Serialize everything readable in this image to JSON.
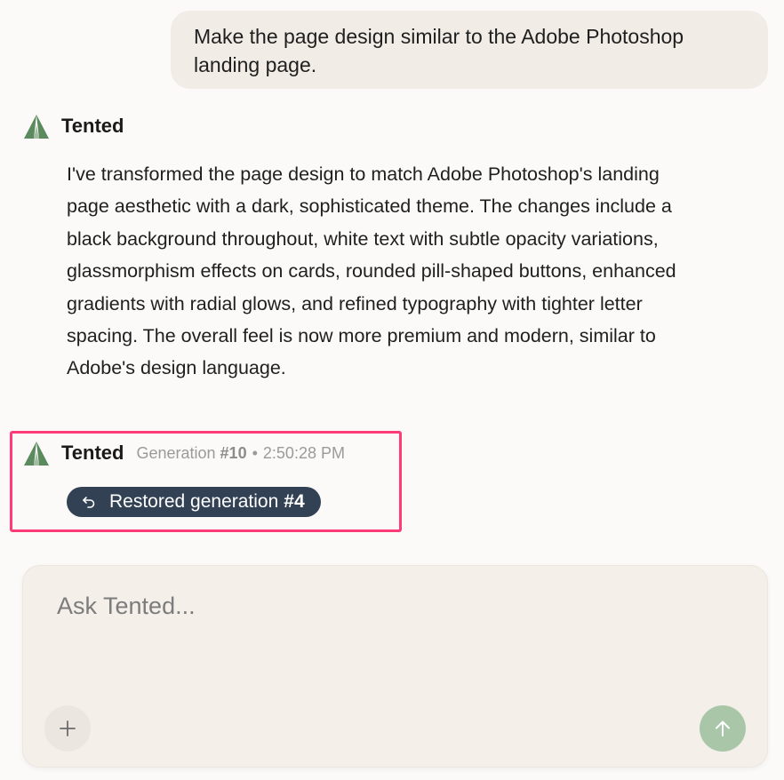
{
  "user_message": {
    "text": "Make the page design similar to the Adobe Photoshop landing page."
  },
  "assistant": {
    "name": "Tented",
    "message": "I've transformed the page design to match Adobe Photoshop's landing page aesthetic with a dark, sophisticated theme. The changes include a black background throughout, white text with subtle opacity variations, glassmorphism effects on cards, rounded pill-shaped buttons, enhanced gradients with radial glows, and refined typography with tighter letter spacing. The overall feel is now more premium and modern, similar to Adobe's design language."
  },
  "generation_entry": {
    "name": "Tented",
    "generation_prefix": "Generation ",
    "generation_number": "#10",
    "separator": "•",
    "time": "2:50:28 PM",
    "restored_label": "Restored generation",
    "restored_number": "#4",
    "undo_icon": "undo-icon"
  },
  "composer": {
    "placeholder": "Ask Tented...",
    "add_icon": "plus-icon",
    "send_icon": "arrow-up-icon"
  },
  "colors": {
    "logo_green": "#5b8a5e",
    "pill_bg": "#334155",
    "highlight": "#ff3b77",
    "send_bg": "#a9c6a8"
  }
}
